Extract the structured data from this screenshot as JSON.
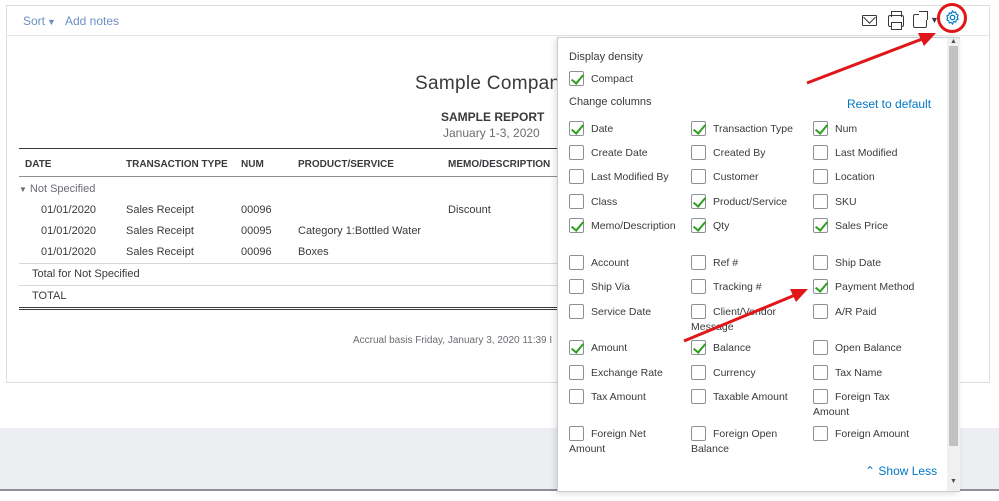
{
  "toolbar": {
    "sort_label": "Sort",
    "add_notes_label": "Add notes"
  },
  "report": {
    "company": "Sample Company",
    "title": "SAMPLE REPORT",
    "date_range": "January 1-3, 2020",
    "columns": [
      "DATE",
      "TRANSACTION TYPE",
      "NUM",
      "PRODUCT/SERVICE",
      "MEMO/DESCRIPTION"
    ],
    "group_label": "Not Specified",
    "rows": [
      {
        "date": "01/01/2020",
        "type": "Sales Receipt",
        "num": "00096",
        "product": "",
        "memo": "Discount"
      },
      {
        "date": "01/01/2020",
        "type": "Sales Receipt",
        "num": "00095",
        "product": "Category 1:Bottled Water",
        "memo": ""
      },
      {
        "date": "01/01/2020",
        "type": "Sales Receipt",
        "num": "00096",
        "product": "Boxes",
        "memo": ""
      }
    ],
    "group_total_label": "Total for Not Specified",
    "total_label": "TOTAL",
    "footer": "Accrual basis  Friday, January 3, 2020  11:39 I"
  },
  "panel": {
    "display_density_label": "Display density",
    "compact_label": "Compact",
    "compact_checked": true,
    "change_columns_label": "Change columns",
    "reset_label": "Reset to default",
    "show_less_label": "Show Less",
    "columns": [
      {
        "label": "Date",
        "checked": true
      },
      {
        "label": "Transaction Type",
        "checked": true
      },
      {
        "label": "Num",
        "checked": true
      },
      {
        "label": "Create Date",
        "checked": false
      },
      {
        "label": "Created By",
        "checked": false
      },
      {
        "label": "Last Modified",
        "checked": false
      },
      {
        "label": "Last Modified By",
        "checked": false
      },
      {
        "label": "Customer",
        "checked": false
      },
      {
        "label": "Location",
        "checked": false
      },
      {
        "label": "Class",
        "checked": false
      },
      {
        "label": "Product/Service",
        "checked": true
      },
      {
        "label": "SKU",
        "checked": false
      },
      {
        "label": "Memo/Description",
        "checked": true
      },
      {
        "label": "Qty",
        "checked": true
      },
      {
        "label": "Sales Price",
        "checked": true
      },
      {
        "label": "Account",
        "checked": false
      },
      {
        "label": "Ref #",
        "checked": false
      },
      {
        "label": "Ship Date",
        "checked": false
      },
      {
        "label": "Ship Via",
        "checked": false
      },
      {
        "label": "Tracking #",
        "checked": false
      },
      {
        "label": "Payment Method",
        "checked": true
      },
      {
        "label": "Service Date",
        "checked": false
      },
      {
        "label": "Client/Vendor Message",
        "checked": false
      },
      {
        "label": "A/R Paid",
        "checked": false
      },
      {
        "label": "Amount",
        "checked": true
      },
      {
        "label": "Balance",
        "checked": true
      },
      {
        "label": "Open Balance",
        "checked": false
      },
      {
        "label": "Exchange Rate",
        "checked": false
      },
      {
        "label": "Currency",
        "checked": false
      },
      {
        "label": "Tax Name",
        "checked": false
      },
      {
        "label": "Tax Amount",
        "checked": false
      },
      {
        "label": "Taxable Amount",
        "checked": false
      },
      {
        "label": "Foreign Tax Amount",
        "checked": false
      },
      {
        "label": "Foreign Net Amount",
        "checked": false
      },
      {
        "label": "Foreign Open Balance",
        "checked": false
      },
      {
        "label": "Foreign Amount",
        "checked": false
      }
    ]
  },
  "colors": {
    "link": "#0077c5",
    "check": "#2ca01c",
    "annotation": "#e0161a"
  }
}
